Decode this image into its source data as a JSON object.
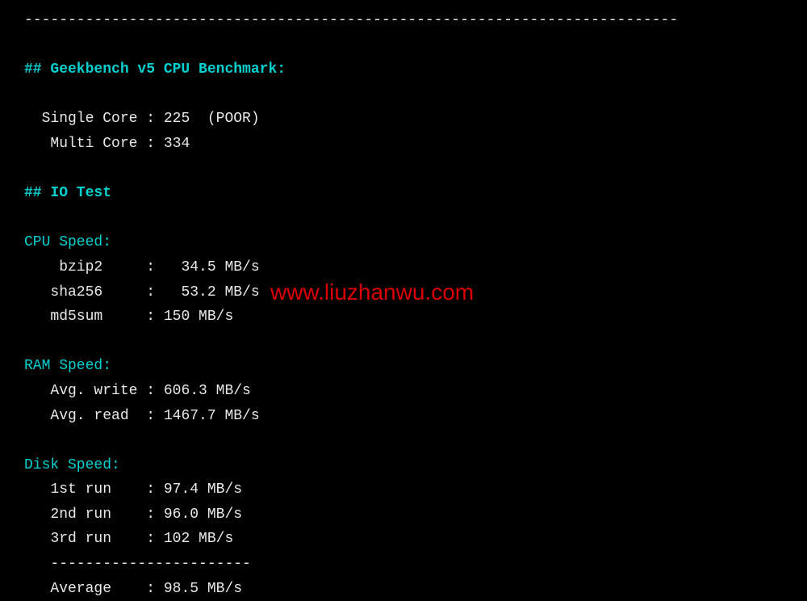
{
  "divider_top": "---------------------------------------------------------------------------",
  "geekbench": {
    "header": "## Geekbench v5 CPU Benchmark:",
    "single_label": "  Single Core",
    "single_value": "225  (POOR)",
    "multi_label": "   Multi Core",
    "multi_value": "334"
  },
  "io_header": "## IO Test",
  "cpu_speed": {
    "header": "CPU Speed:",
    "bzip2_label": "    bzip2",
    "bzip2_value": " 34.5 MB/s",
    "sha256_label": "   sha256",
    "sha256_value": " 53.2 MB/s",
    "md5sum_label": "   md5sum",
    "md5sum_value": "150 MB/s"
  },
  "ram_speed": {
    "header": "RAM Speed:",
    "write_label": "   Avg. write",
    "write_value": "606.3 MB/s",
    "read_label": "   Avg. read ",
    "read_value": "1467.7 MB/s"
  },
  "disk_speed": {
    "header": "Disk Speed:",
    "run1_label": "   1st run",
    "run1_value": "97.4 MB/s",
    "run2_label": "   2nd run",
    "run2_value": "96.0 MB/s",
    "run3_label": "   3rd run",
    "run3_value": "102 MB/s",
    "sub_divider": "   -----------------------",
    "avg_label": "   Average",
    "avg_value": "98.5 MB/s"
  },
  "watermark": "www.liuzhanwu.com"
}
